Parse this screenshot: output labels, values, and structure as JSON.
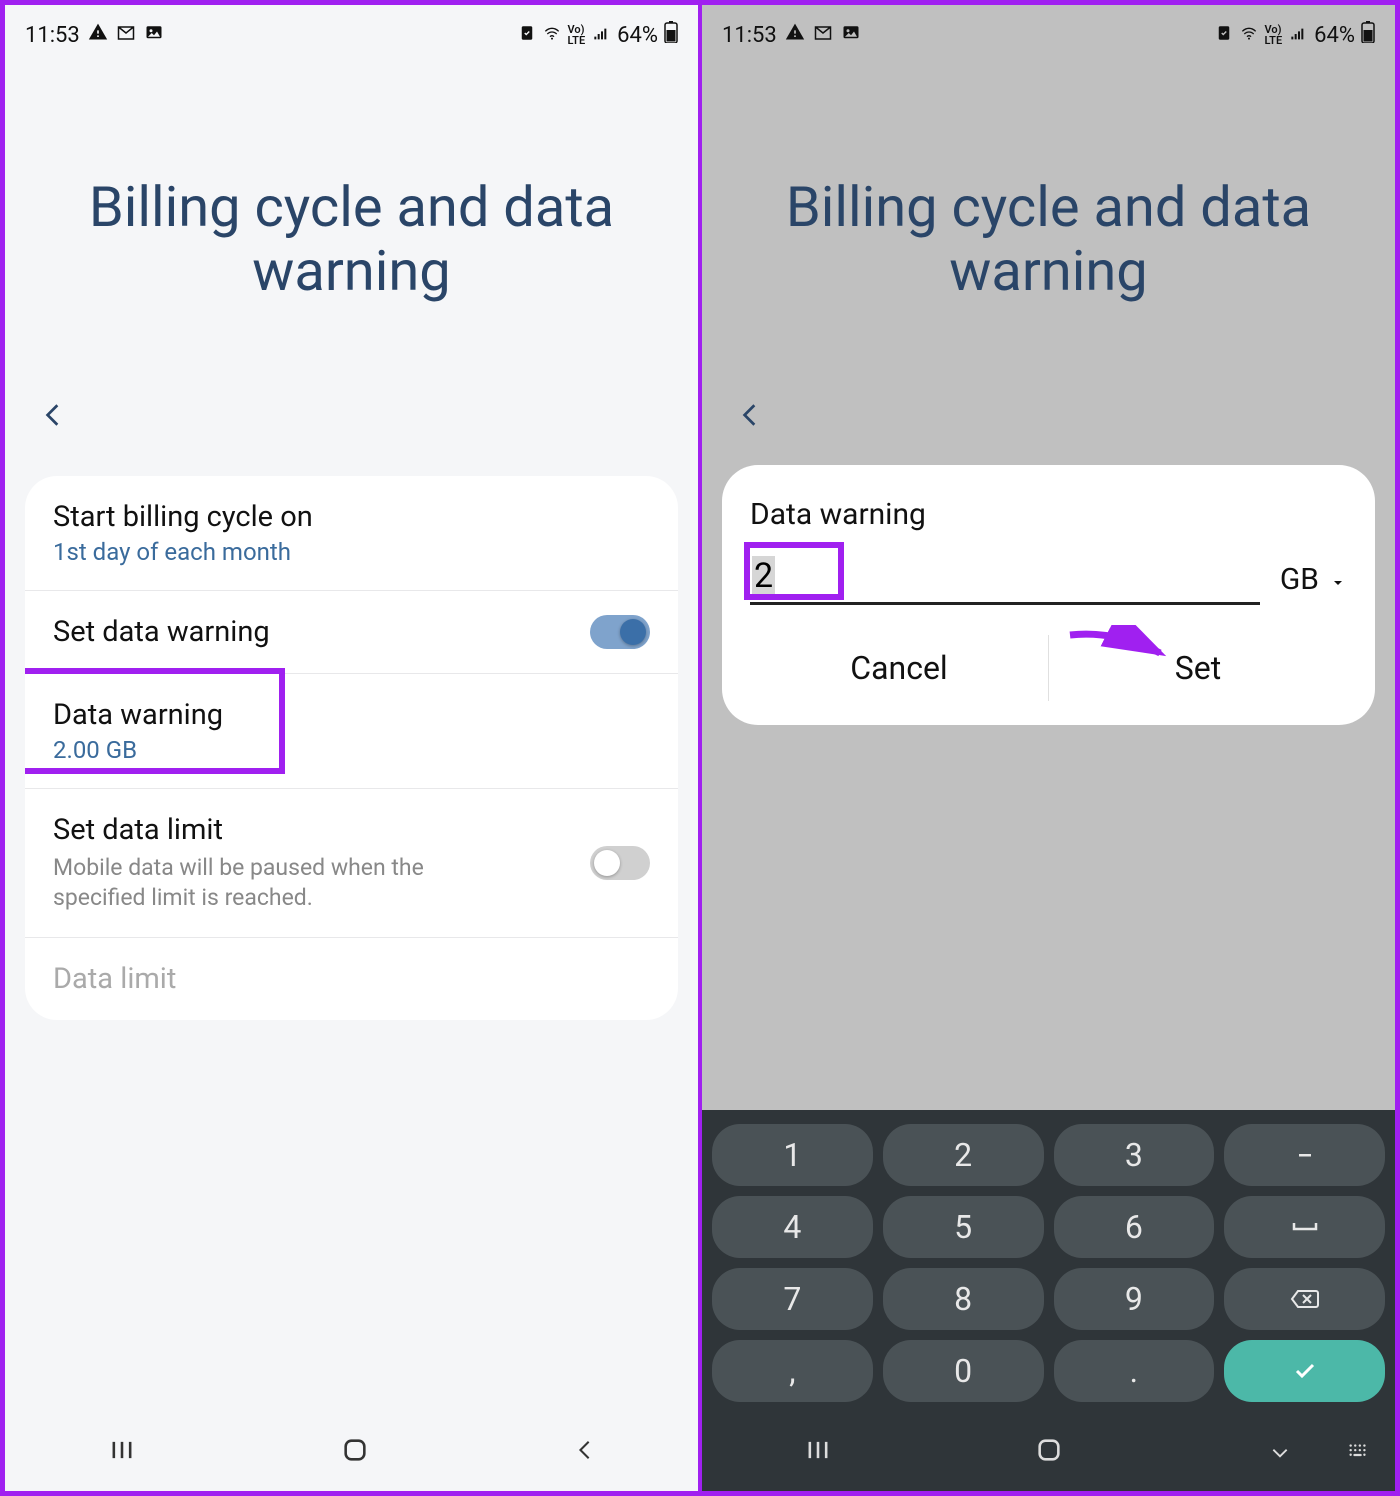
{
  "status": {
    "time": "11:53",
    "battery_pct": "64%",
    "icons_left": [
      "warning-icon",
      "gmail-icon",
      "gallery-icon"
    ],
    "icons_right": [
      "alarm-icon",
      "wifi-icon",
      "volte-icon",
      "signal-icon",
      "battery-icon"
    ]
  },
  "page": {
    "title": "Billing cycle and data warning"
  },
  "rows": {
    "billing_cycle": {
      "title": "Start billing cycle on",
      "sub": "1st day of each month"
    },
    "set_warning": {
      "title": "Set data warning",
      "on": true
    },
    "data_warning": {
      "title": "Data warning",
      "sub": "2.00 GB"
    },
    "set_limit": {
      "title": "Set data limit",
      "desc": "Mobile data will be paused when the specified limit is reached.",
      "on": false
    },
    "data_limit": {
      "title": "Data limit"
    }
  },
  "dialog": {
    "title": "Data warning",
    "value": "2",
    "unit": "GB",
    "cancel": "Cancel",
    "set": "Set"
  },
  "keyboard": {
    "rows": [
      [
        "1",
        "2",
        "3",
        "-"
      ],
      [
        "4",
        "5",
        "6",
        "␣"
      ],
      [
        "7",
        "8",
        "9",
        "⌫"
      ],
      [
        ",",
        "0",
        ".",
        "✓"
      ]
    ]
  },
  "nav": {
    "recents": "|||",
    "home": "◯",
    "back_left": "⟨",
    "back_right": "⌄",
    "kb_toggle": "⌨"
  }
}
